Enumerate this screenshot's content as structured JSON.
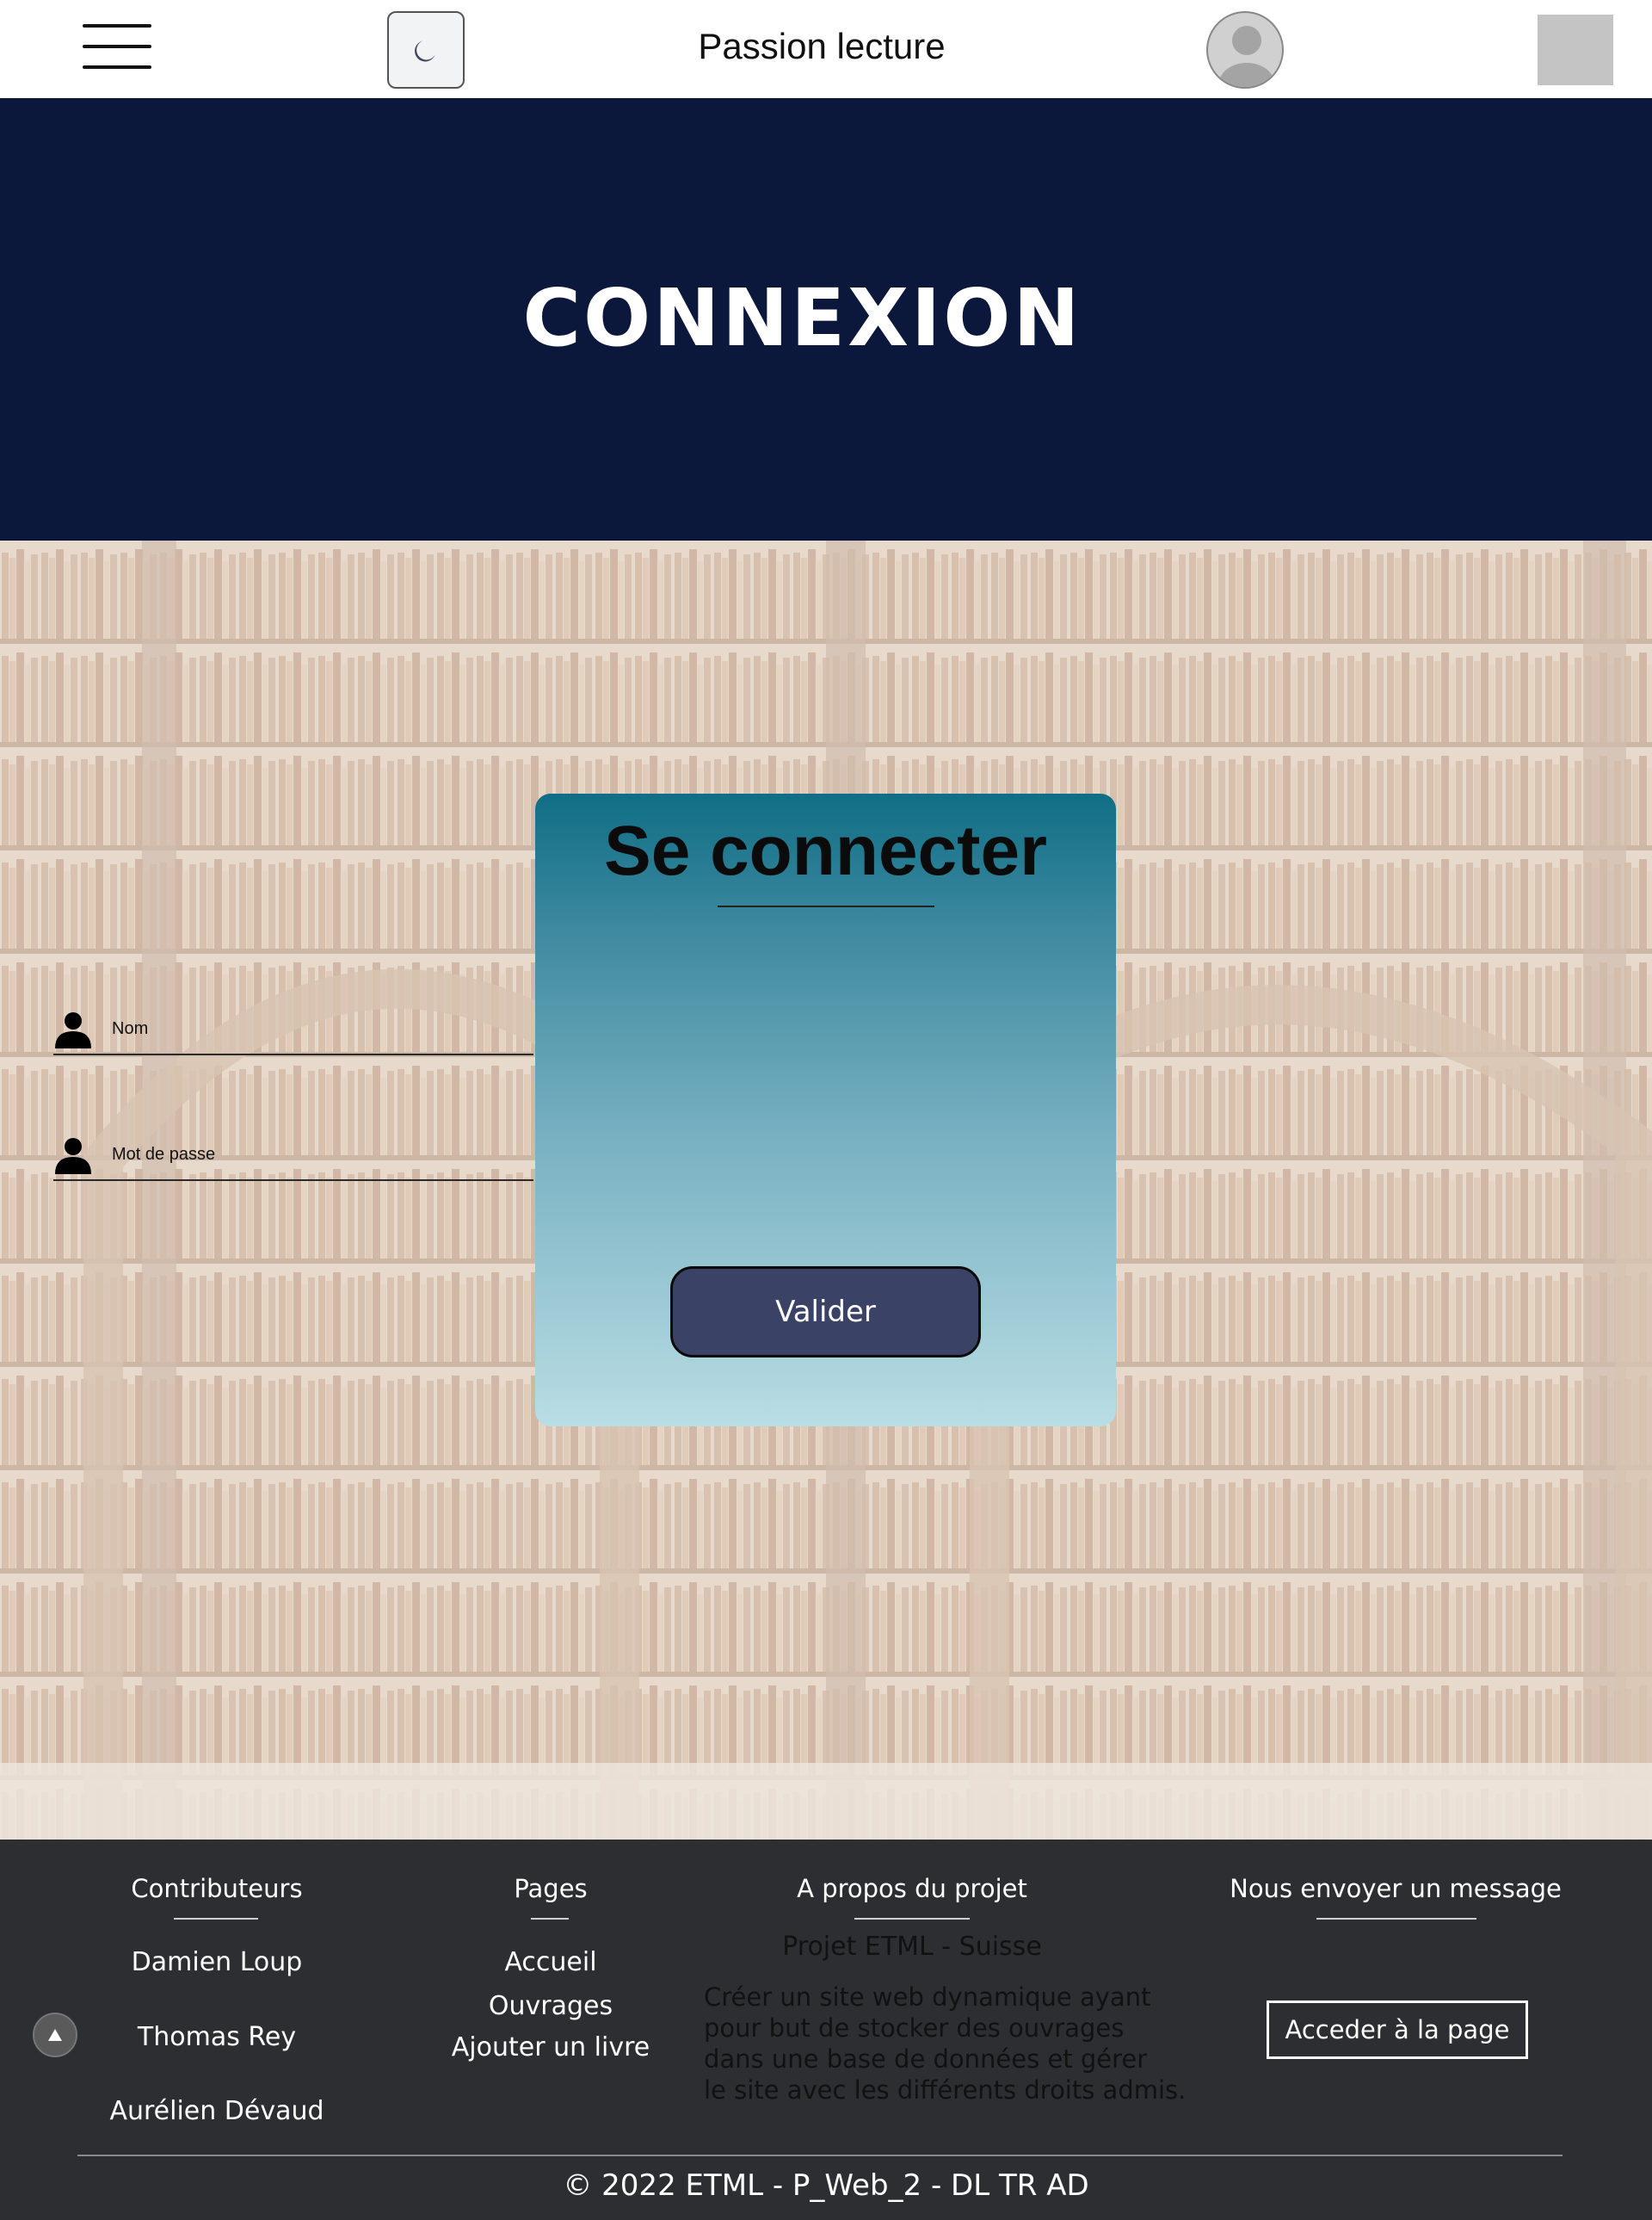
{
  "navbar": {
    "menu_icon": "hamburger-menu-icon",
    "theme_icon": "moon-icon",
    "brand": "Passion lecture",
    "avatar_icon": "user-avatar-icon"
  },
  "hero": {
    "title": "CONNEXION",
    "background_color": "#0b173b"
  },
  "login": {
    "title": "Se connecter",
    "username_placeholder": "Nom",
    "password_placeholder": "Mot de passe",
    "field_icon": "user-icon",
    "submit_label": "Valider",
    "submit_color": "#3a4266"
  },
  "footer": {
    "contributors": {
      "heading": "Contributeurs",
      "names": [
        "Damien Loup",
        "Thomas Rey",
        "Aurélien Dévaud"
      ]
    },
    "pages": {
      "heading": "Pages",
      "links": [
        "Accueil",
        "Ouvrages",
        "Ajouter un livre"
      ]
    },
    "about": {
      "heading": "A propos du projet",
      "subtitle": "Projet ETML - Suisse",
      "lines": [
        "Créer un site web dynamique ayant",
        "pour but de stocker des ouvrages",
        "dans une base de données et gérer",
        "le site avec les différents droits admis."
      ]
    },
    "message": {
      "heading": "Nous envoyer un message",
      "button_label": "Acceder à la page"
    },
    "scroll_top_icon": "arrow-up-icon",
    "copyright": "© 2022 ETML - P_Web_2 - DL TR AD",
    "background_color": "#2d2e31"
  }
}
